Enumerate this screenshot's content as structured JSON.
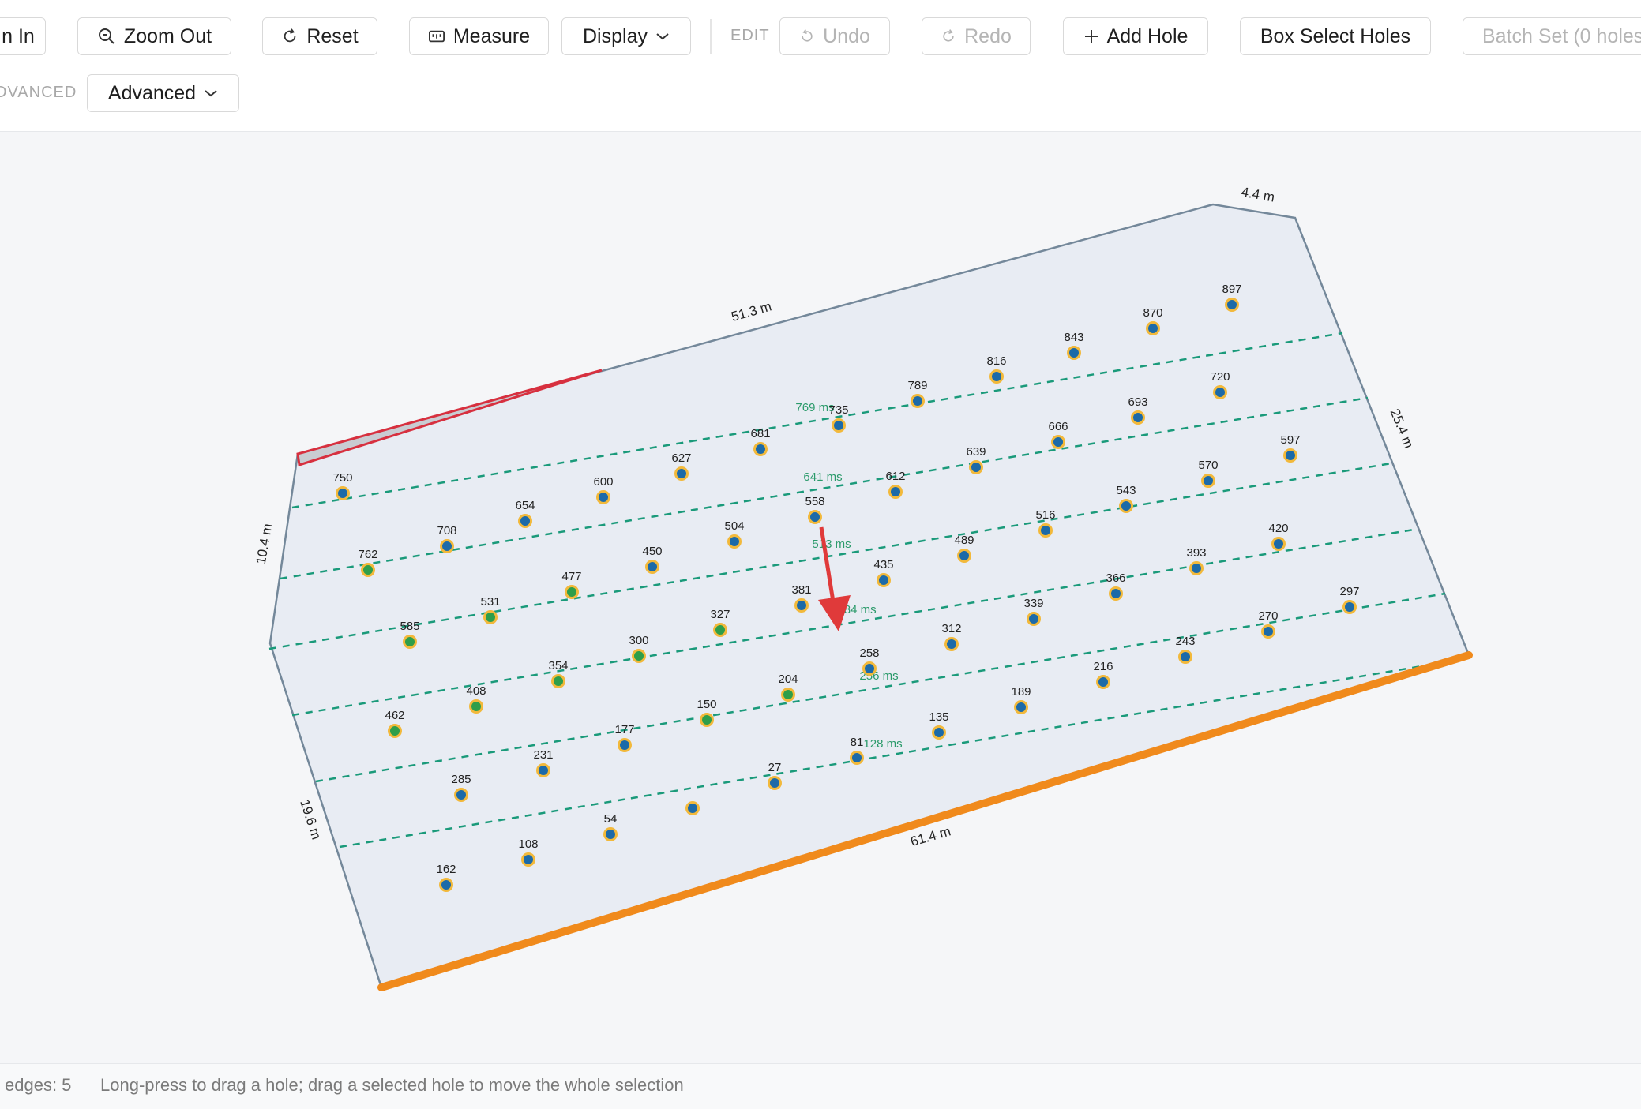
{
  "toolbar": {
    "zoom_in_label": "n In",
    "zoom_out_label": "Zoom Out",
    "reset_label": "Reset",
    "measure_label": "Measure",
    "display_label": "Display",
    "edit_section_label": "EDIT",
    "undo_label": "Undo",
    "redo_label": "Redo",
    "add_hole_label": "Add Hole",
    "box_select_label": "Box Select Holes",
    "batch_set_label": "Batch Set (0 holes",
    "advanced_section_label": "DVANCED",
    "advanced_label": "Advanced"
  },
  "canvas": {
    "edge_lengths": [
      "51.3 m",
      "4.4 m",
      "25.4 m",
      "61.4 m",
      "19.6 m",
      "10.4 m"
    ],
    "timing_labels": [
      "769 ms",
      "641 ms",
      "513 ms",
      "384 ms",
      "256 ms",
      "128 ms"
    ],
    "holes": [
      {
        "label": "897",
        "color": "blue"
      },
      {
        "label": "870",
        "color": "blue"
      },
      {
        "label": "843",
        "color": "blue"
      },
      {
        "label": "816",
        "color": "blue"
      },
      {
        "label": "789",
        "color": "blue"
      },
      {
        "label": "735",
        "color": "blue"
      },
      {
        "label": "681",
        "color": "blue"
      },
      {
        "label": "627",
        "color": "blue"
      },
      {
        "label": "600",
        "color": "blue"
      },
      {
        "label": "654",
        "color": "blue"
      },
      {
        "label": "750",
        "color": "blue"
      },
      {
        "label": "720",
        "color": "blue"
      },
      {
        "label": "693",
        "color": "blue"
      },
      {
        "label": "666",
        "color": "blue"
      },
      {
        "label": "639",
        "color": "blue"
      },
      {
        "label": "612",
        "color": "blue"
      },
      {
        "label": "558",
        "color": "blue"
      },
      {
        "label": "504",
        "color": "blue"
      },
      {
        "label": "450",
        "color": "blue"
      },
      {
        "label": "708",
        "color": "blue"
      },
      {
        "label": "762",
        "color": "green"
      },
      {
        "label": "597",
        "color": "blue"
      },
      {
        "label": "570",
        "color": "blue"
      },
      {
        "label": "543",
        "color": "blue"
      },
      {
        "label": "516",
        "color": "blue"
      },
      {
        "label": "489",
        "color": "blue"
      },
      {
        "label": "435",
        "color": "blue"
      },
      {
        "label": "381",
        "color": "blue"
      },
      {
        "label": "327",
        "color": "green"
      },
      {
        "label": "477",
        "color": "green"
      },
      {
        "label": "531",
        "color": "green"
      },
      {
        "label": "585",
        "color": "green"
      },
      {
        "label": "420",
        "color": "blue"
      },
      {
        "label": "393",
        "color": "blue"
      },
      {
        "label": "366",
        "color": "blue"
      },
      {
        "label": "339",
        "color": "blue"
      },
      {
        "label": "312",
        "color": "blue"
      },
      {
        "label": "258",
        "color": "blue"
      },
      {
        "label": "300",
        "color": "green"
      },
      {
        "label": "354",
        "color": "green"
      },
      {
        "label": "408",
        "color": "green"
      },
      {
        "label": "462",
        "color": "green"
      },
      {
        "label": "297",
        "color": "blue"
      },
      {
        "label": "270",
        "color": "blue"
      },
      {
        "label": "243",
        "color": "blue"
      },
      {
        "label": "216",
        "color": "blue"
      },
      {
        "label": "189",
        "color": "blue"
      },
      {
        "label": "204",
        "color": "green"
      },
      {
        "label": "150",
        "color": "green"
      },
      {
        "label": "177",
        "color": "blue"
      },
      {
        "label": "231",
        "color": "blue"
      },
      {
        "label": "285",
        "color": "blue"
      },
      {
        "label": "135",
        "color": "blue"
      },
      {
        "label": "81",
        "color": "blue"
      },
      {
        "label": "27",
        "color": "blue"
      },
      {
        "label": "",
        "color": "blue"
      },
      {
        "label": "54",
        "color": "blue"
      },
      {
        "label": "108",
        "color": "blue"
      },
      {
        "label": "162",
        "color": "blue"
      }
    ],
    "colors": {
      "polygon_fill": "#e8ecf3",
      "polygon_stroke": "#74889a",
      "free_face": "#f08a1c",
      "restricted_edge": "#d7303f",
      "row_line": "#1a9a7a",
      "arrow": "#e03a3a",
      "hole_ring": "#f2b93b",
      "hole_blue": "#1c6aa8",
      "hole_green": "#2e9e4a"
    }
  },
  "status": {
    "edges_text": "edges: 5",
    "hint_text": "Long-press to drag a hole; drag a selected hole to move the whole selection"
  }
}
